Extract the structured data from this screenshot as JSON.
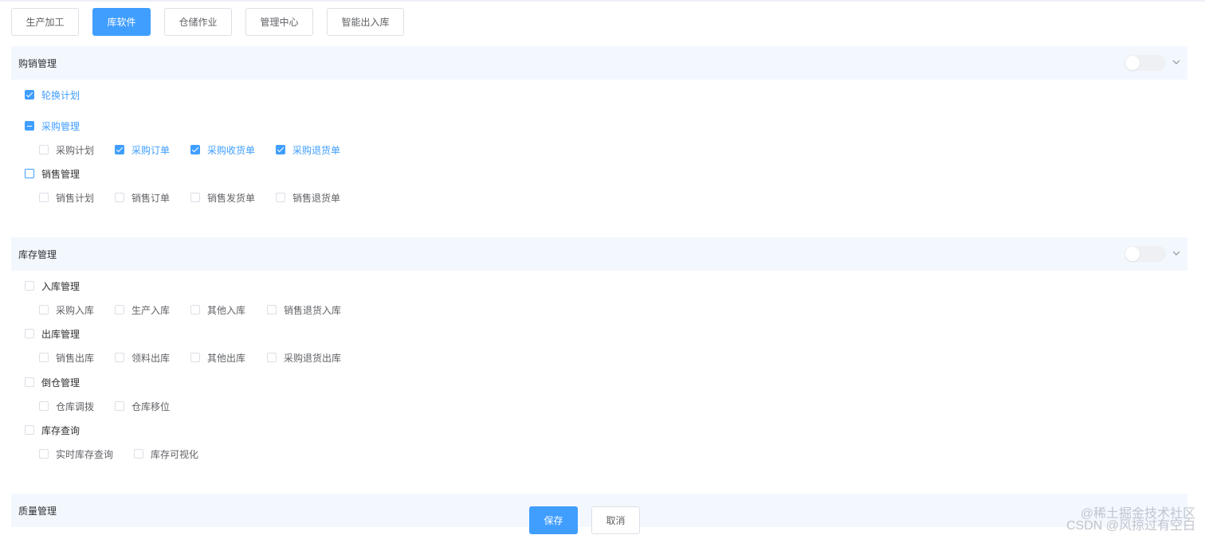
{
  "tabs": [
    {
      "label": "生产加工",
      "active": false
    },
    {
      "label": "库软件",
      "active": true
    },
    {
      "label": "仓储作业",
      "active": false
    },
    {
      "label": "管理中心",
      "active": false
    },
    {
      "label": "智能出入库",
      "active": false
    }
  ],
  "sections": [
    {
      "title": "购销管理",
      "enabled": false,
      "groups": [
        {
          "label": "轮换计划",
          "state": "checked",
          "children": []
        },
        {
          "label": "采购管理",
          "state": "indeterminate",
          "children": [
            {
              "label": "采购计划",
              "checked": false
            },
            {
              "label": "采购订单",
              "checked": true
            },
            {
              "label": "采购收货单",
              "checked": true
            },
            {
              "label": "采购退货单",
              "checked": true
            }
          ]
        },
        {
          "label": "销售管理",
          "state": "unchecked",
          "children": [
            {
              "label": "销售计划",
              "checked": false
            },
            {
              "label": "销售订单",
              "checked": false
            },
            {
              "label": "销售发货单",
              "checked": false
            },
            {
              "label": "销售退货单",
              "checked": false
            }
          ]
        }
      ]
    },
    {
      "title": "库存管理",
      "enabled": false,
      "groups": [
        {
          "label": "入库管理",
          "state": "unchecked",
          "children": [
            {
              "label": "采购入库",
              "checked": false
            },
            {
              "label": "生产入库",
              "checked": false
            },
            {
              "label": "其他入库",
              "checked": false
            },
            {
              "label": "销售退货入库",
              "checked": false
            }
          ]
        },
        {
          "label": "出库管理",
          "state": "unchecked",
          "children": [
            {
              "label": "销售出库",
              "checked": false
            },
            {
              "label": "领料出库",
              "checked": false
            },
            {
              "label": "其他出库",
              "checked": false
            },
            {
              "label": "采购退货出库",
              "checked": false
            }
          ]
        },
        {
          "label": "倒仓管理",
          "state": "unchecked",
          "children": [
            {
              "label": "仓库调拨",
              "checked": false
            },
            {
              "label": "仓库移位",
              "checked": false
            }
          ]
        },
        {
          "label": "库存查询",
          "state": "unchecked",
          "children": [
            {
              "label": "实时库存查询",
              "checked": false
            },
            {
              "label": "库存可视化",
              "checked": false
            }
          ]
        }
      ]
    },
    {
      "title": "质量管理",
      "enabled": false,
      "groups": []
    }
  ],
  "actions": {
    "save_label": "保存",
    "cancel_label": "取消"
  },
  "watermark": {
    "line1": "@稀土掘金技术社区",
    "line2": "CSDN @风掠过有空白"
  },
  "colors": {
    "accent": "#409eff",
    "header_bg": "#f3f8ff",
    "border": "#dcdfe6"
  }
}
